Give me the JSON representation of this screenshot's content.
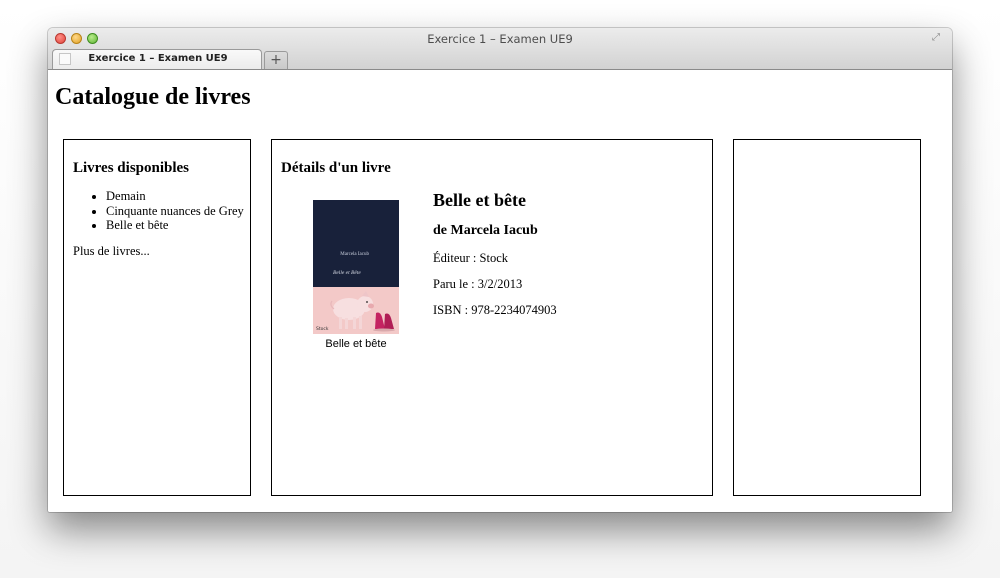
{
  "window": {
    "title": "Exercice 1 – Examen UE9",
    "tab_label": "Exercice 1 – Examen UE9",
    "new_tab_label": "+"
  },
  "page": {
    "title": "Catalogue de livres"
  },
  "available_books": {
    "heading": "Livres disponibles",
    "items": [
      "Demain",
      "Cinquante nuances de Grey",
      "Belle et bête"
    ],
    "more_link": "Plus de livres..."
  },
  "book_details": {
    "heading": "Détails d'un livre",
    "cover": {
      "author_text": "Marcela Iacub",
      "title_text": "Belle et Bête",
      "publisher_text": "Stock",
      "top_color": "#18213a",
      "bottom_color": "#f3c9c8"
    },
    "caption": "Belle et bête",
    "title": "Belle et bête",
    "author": "de Marcela Iacub",
    "publisher": "Éditeur : Stock",
    "published": "Paru le : 3/2/2013",
    "isbn": "ISBN : 978-2234074903"
  },
  "colors": {
    "close": "#e0443a",
    "minimize": "#e0a123",
    "maximize": "#5fb433"
  },
  "icons": {
    "fullscreen": "fullscreen-arrows-icon"
  }
}
